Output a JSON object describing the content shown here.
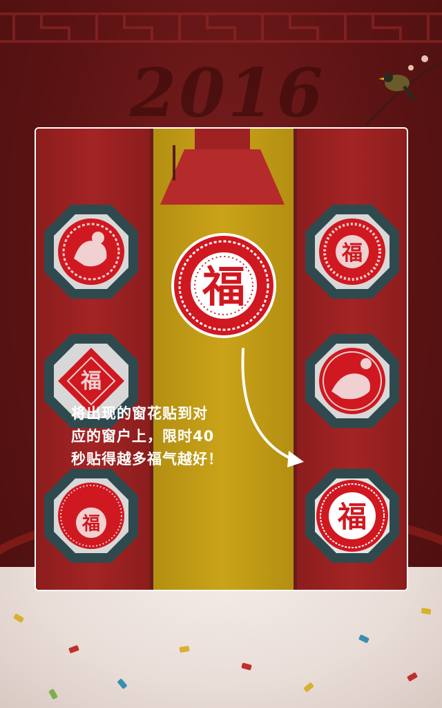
{
  "background": {
    "year_text": "2016",
    "colors": {
      "deep_red": "#5c1313",
      "paper_red": "#d01820",
      "gold": "#caa319",
      "frame_teal": "#2f4a4e"
    }
  },
  "overlay": {
    "instruction_lines": [
      "将出现的窗花贴到对",
      "应的窗户上，限时40",
      "秒贴得越多福气越好！"
    ]
  },
  "game": {
    "falling_papercut": "fu-papercut",
    "left_windows": [
      "monkey-papercut",
      "fu-diamond-papercut",
      "fu-ornate-papercut"
    ],
    "right_windows": [
      "fu-ring-papercut",
      "monkey-flower-papercut",
      "fu-papercut"
    ]
  }
}
